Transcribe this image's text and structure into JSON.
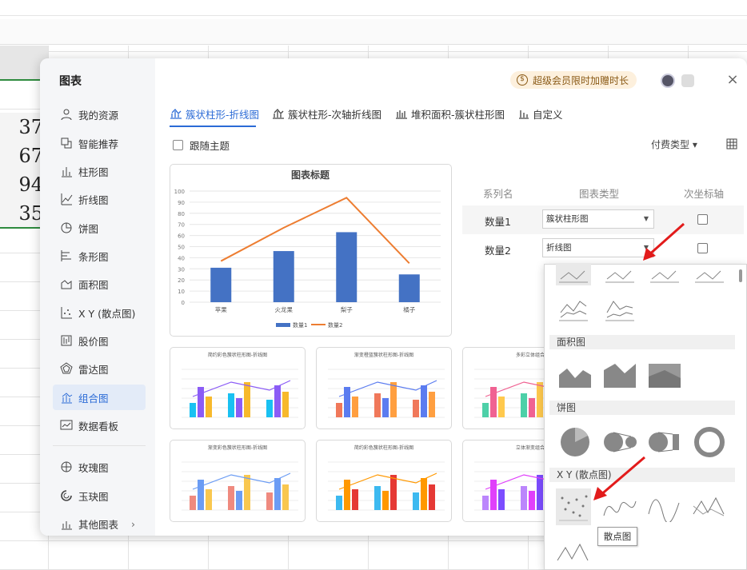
{
  "ribbon": {
    "left": "…",
    "right": "…"
  },
  "sheet_cells": [
    "37",
    "67",
    "94",
    "35"
  ],
  "dialog": {
    "title": "图表",
    "promo": "超级会员限时加赠时长",
    "close": "×",
    "sidebar": [
      {
        "label": "我的资源",
        "icon": "user-icon"
      },
      {
        "label": "智能推荐",
        "icon": "smart-icon"
      },
      {
        "label": "柱形图",
        "icon": "column-chart-icon"
      },
      {
        "label": "折线图",
        "icon": "line-chart-icon"
      },
      {
        "label": "饼图",
        "icon": "pie-chart-icon"
      },
      {
        "label": "条形图",
        "icon": "bar-chart-icon"
      },
      {
        "label": "面积图",
        "icon": "area-chart-icon"
      },
      {
        "label": "X Y (散点图)",
        "icon": "scatter-chart-icon"
      },
      {
        "label": "股价图",
        "icon": "stock-chart-icon"
      },
      {
        "label": "雷达图",
        "icon": "radar-chart-icon"
      },
      {
        "label": "组合图",
        "icon": "combo-chart-icon"
      },
      {
        "label": "数据看板",
        "icon": "dashboard-icon"
      },
      {
        "label": "玫瑰图",
        "icon": "rose-chart-icon"
      },
      {
        "label": "玉玦图",
        "icon": "jade-chart-icon"
      },
      {
        "label": "其他图表",
        "icon": "more-chart-icon"
      }
    ],
    "tabs": [
      "簇状柱形-折线图",
      "簇状柱形-次轴折线图",
      "堆积面积-簇状柱形图",
      "自定义"
    ],
    "follow_theme": "跟随主题",
    "pay_type": "付费类型 ▾",
    "series_table": {
      "headers": [
        "系列名",
        "图表类型",
        "次坐标轴"
      ],
      "rows": [
        {
          "name": "数量1",
          "type": "簇状柱形图",
          "secondary": false
        },
        {
          "name": "数量2",
          "type": "折线图",
          "secondary": false
        }
      ]
    },
    "templates": [
      "简约彩色簇状柱形图-折线图",
      "渐变橙蓝簇状柱形图-折线图",
      "多彩立体组合",
      "渐变彩色簇状柱形图-折线图",
      "简约彩色簇状柱形图-折线图",
      "立体渐变组合"
    ],
    "dropdown": {
      "sections": [
        "面积图",
        "饼图",
        "X Y (散点图)"
      ],
      "tooltip": "散点图"
    }
  },
  "chart_data": {
    "type": "bar",
    "title": "图表标题",
    "categories": [
      "苹果",
      "火龙果",
      "梨子",
      "橘子"
    ],
    "series": [
      {
        "name": "数量1",
        "type": "bar",
        "values": [
          31,
          46,
          63,
          25
        ]
      },
      {
        "name": "数量2",
        "type": "line",
        "values": [
          37,
          67,
          94,
          35
        ]
      }
    ],
    "ylim": [
      0,
      100
    ],
    "yticks": [
      "0",
      "10",
      "20",
      "30",
      "40",
      "50",
      "60",
      "70",
      "80",
      "90",
      "100"
    ],
    "legend": "bottom",
    "colors": {
      "bar": "#4472c4",
      "line": "#ed7d31"
    }
  }
}
